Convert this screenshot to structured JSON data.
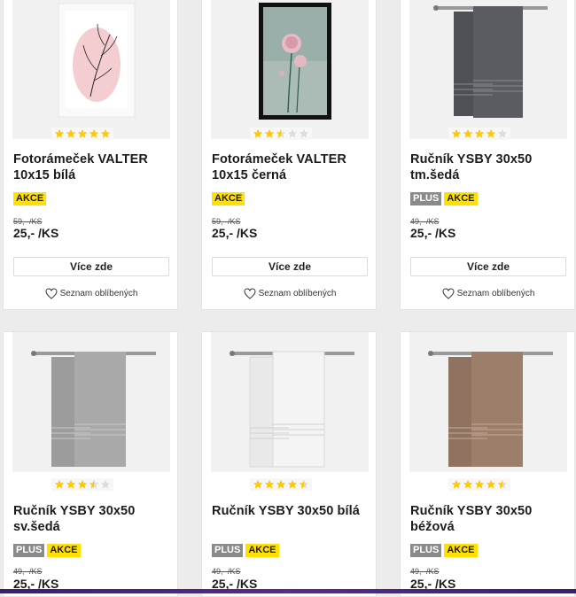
{
  "colors": {
    "akce_badge": "#ffe000",
    "plus_badge": "#8a8a8a",
    "star": "#ffc800",
    "star_empty": "#dcdcdc"
  },
  "products": [
    {
      "title_line1": "Fotorámeček VALTER",
      "title_line2": "10x15 bílá",
      "rating": 5,
      "plus": false,
      "akce": "AKCE",
      "old_price": "59,- /KS",
      "price": "25,- /KS",
      "button": "Více zde",
      "wishlist": "Seznam oblíbených",
      "image": "white-frame-pink-leaf-icon"
    },
    {
      "title_line1": "Fotorámeček VALTER",
      "title_line2": "10x15 černá",
      "rating": 2.5,
      "plus": false,
      "akce": "AKCE",
      "old_price": "59,- /KS",
      "price": "25,- /KS",
      "button": "Více zde",
      "wishlist": "Seznam oblíbených",
      "image": "black-frame-flower-icon"
    },
    {
      "title_line1": "Ručník YSBY 30x50",
      "title_line2": "tm.šedá",
      "rating": 4,
      "plus": true,
      "plus_label": "PLUS",
      "akce": "AKCE",
      "old_price": "49,- /KS",
      "price": "25,- /KS",
      "button": "Více zde",
      "wishlist": "Seznam oblíbených",
      "image": "dark-grey-towel-icon"
    },
    {
      "title_line1": "Ručník YSBY 30x50",
      "title_line2": "sv.šedá",
      "rating": 3.5,
      "plus": true,
      "plus_label": "PLUS",
      "akce": "AKCE",
      "old_price": "49,- /KS",
      "price": "25,- /KS",
      "image": "light-grey-towel-icon"
    },
    {
      "title_line1": "Ručník YSBY 30x50 bílá",
      "title_line2": "",
      "rating": 4.5,
      "plus": true,
      "plus_label": "PLUS",
      "akce": "AKCE",
      "old_price": "49,- /KS",
      "price": "25,- /KS",
      "image": "white-towel-icon"
    },
    {
      "title_line1": "Ručník YSBY 30x50",
      "title_line2": "béžová",
      "rating": 4.5,
      "plus": true,
      "plus_label": "PLUS",
      "akce": "AKCE",
      "old_price": "49,- /KS",
      "price": "25,- /KS",
      "image": "beige-towel-icon"
    }
  ]
}
